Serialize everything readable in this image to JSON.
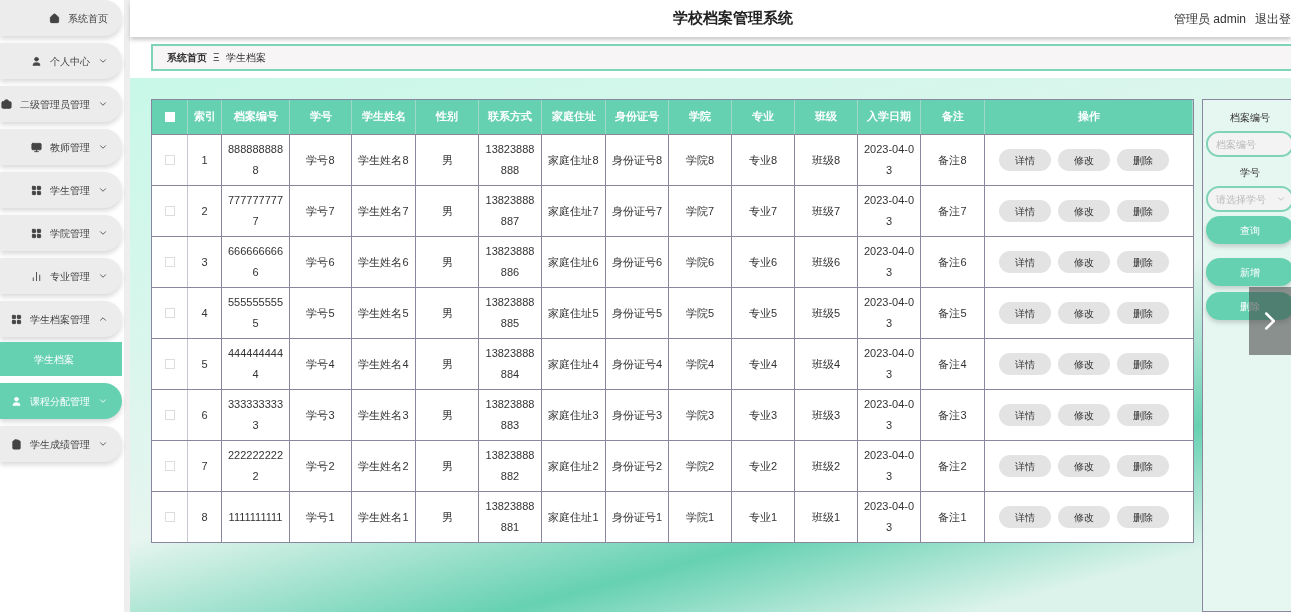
{
  "header": {
    "title": "学校档案管理系统",
    "user": "管理员 admin",
    "logout": "退出登"
  },
  "sidebar": {
    "items": [
      {
        "label": "系统首页",
        "highlighted": false
      },
      {
        "label": "个人中心",
        "expanded": false,
        "highlighted": false
      },
      {
        "label": "二级管理员管理",
        "expanded": false,
        "highlighted": false
      },
      {
        "label": "教师管理",
        "expanded": false,
        "highlighted": false
      },
      {
        "label": "学生管理",
        "expanded": false,
        "highlighted": false
      },
      {
        "label": "学院管理",
        "expanded": false,
        "highlighted": false
      },
      {
        "label": "专业管理",
        "expanded": false,
        "highlighted": false
      },
      {
        "label": "学生档案管理",
        "expanded": true,
        "highlighted": false,
        "children": [
          {
            "label": "学生档案",
            "selected": true
          }
        ]
      },
      {
        "label": "课程分配管理",
        "expanded": false,
        "highlighted": true
      },
      {
        "label": "学生成绩管理",
        "expanded": false,
        "highlighted": false
      }
    ]
  },
  "breadcrumb": {
    "items": [
      "系统首页",
      "学生档案"
    ],
    "separator": "Ξ"
  },
  "table": {
    "header_checkbox": {
      "checked": false
    },
    "columns": [
      "索引",
      "档案编号",
      "学号",
      "学生姓名",
      "性别",
      "联系方式",
      "家庭住址",
      "身份证号",
      "学院",
      "专业",
      "班级",
      "入学日期",
      "备注",
      "操作"
    ],
    "rows": [
      {
        "checked": false,
        "cells": [
          "1",
          "8888888888",
          "学号8",
          "学生姓名8",
          "男",
          "13823888888",
          "家庭住址8",
          "身份证号8",
          "学院8",
          "专业8",
          "班级8",
          "2023-04-03",
          "备注8"
        ],
        "actions": [
          "详情",
          "修改",
          "删除"
        ]
      },
      {
        "checked": false,
        "cells": [
          "2",
          "7777777777",
          "学号7",
          "学生姓名7",
          "男",
          "13823888887",
          "家庭住址7",
          "身份证号7",
          "学院7",
          "专业7",
          "班级7",
          "2023-04-03",
          "备注7"
        ],
        "actions": [
          "详情",
          "修改",
          "删除"
        ]
      },
      {
        "checked": false,
        "cells": [
          "3",
          "6666666666",
          "学号6",
          "学生姓名6",
          "男",
          "13823888886",
          "家庭住址6",
          "身份证号6",
          "学院6",
          "专业6",
          "班级6",
          "2023-04-03",
          "备注6"
        ],
        "actions": [
          "详情",
          "修改",
          "删除"
        ]
      },
      {
        "checked": false,
        "cells": [
          "4",
          "5555555555",
          "学号5",
          "学生姓名5",
          "男",
          "13823888885",
          "家庭住址5",
          "身份证号5",
          "学院5",
          "专业5",
          "班级5",
          "2023-04-03",
          "备注5"
        ],
        "actions": [
          "详情",
          "修改",
          "删除"
        ]
      },
      {
        "checked": false,
        "cells": [
          "5",
          "4444444444",
          "学号4",
          "学生姓名4",
          "男",
          "13823888884",
          "家庭住址4",
          "身份证号4",
          "学院4",
          "专业4",
          "班级4",
          "2023-04-03",
          "备注4"
        ],
        "actions": [
          "详情",
          "修改",
          "删除"
        ]
      },
      {
        "checked": false,
        "cells": [
          "6",
          "3333333333",
          "学号3",
          "学生姓名3",
          "男",
          "13823888883",
          "家庭住址3",
          "身份证号3",
          "学院3",
          "专业3",
          "班级3",
          "2023-04-03",
          "备注3"
        ],
        "actions": [
          "详情",
          "修改",
          "删除"
        ]
      },
      {
        "checked": false,
        "cells": [
          "7",
          "2222222222",
          "学号2",
          "学生姓名2",
          "男",
          "13823888882",
          "家庭住址2",
          "身份证号2",
          "学院2",
          "专业2",
          "班级2",
          "2023-04-03",
          "备注2"
        ],
        "actions": [
          "详情",
          "修改",
          "删除"
        ]
      },
      {
        "checked": false,
        "cells": [
          "8",
          "1111111111",
          "学号1",
          "学生姓名1",
          "男",
          "13823888881",
          "家庭住址1",
          "身份证号1",
          "学院1",
          "专业1",
          "班级1",
          "2023-04-03",
          "备注1"
        ],
        "actions": [
          "详情",
          "修改",
          "删除"
        ]
      }
    ]
  },
  "search": {
    "fields": [
      {
        "label": "档案编号",
        "placeholder": "档案编号",
        "kind": "input"
      },
      {
        "label": "学号",
        "placeholder": "请选择学号",
        "kind": "select"
      }
    ],
    "query_button": "查询",
    "buttons": [
      "新增",
      "删除"
    ]
  }
}
